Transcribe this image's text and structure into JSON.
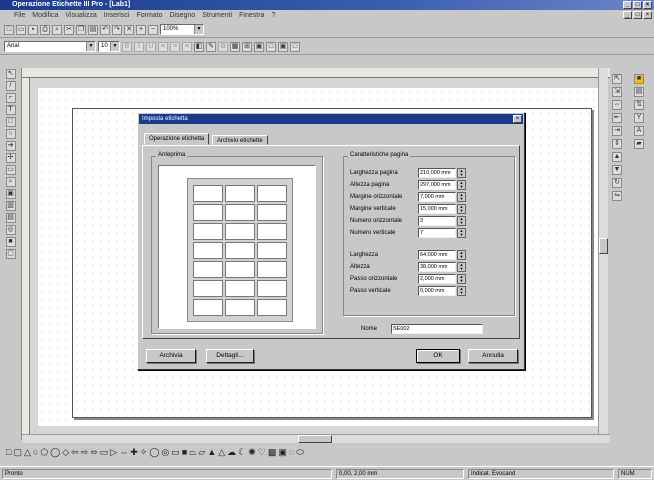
{
  "app": {
    "title": "Operazione Etichette III Pro - [Lab1]"
  },
  "menu": [
    "File",
    "Modifica",
    "Visualizza",
    "Inserisci",
    "Formato",
    "Disegno",
    "Strumenti",
    "Finestra",
    "?"
  ],
  "toolbar": {
    "zoom_value": "100%",
    "font_name": "Arial",
    "font_size": "10"
  },
  "dialog": {
    "title": "Imposta etichetta",
    "tabs": [
      "Operazione etichetta",
      "Archivio etichette"
    ],
    "preview_label": "Anteprima",
    "page_group_label": "Caratteristiche pagina",
    "fields": [
      {
        "label": "Larghezza pagina",
        "value": "210,000 mm"
      },
      {
        "label": "Altezza pagina",
        "value": "297,000 mm"
      },
      {
        "label": "Margine orizzontale",
        "value": "7,000 mm"
      },
      {
        "label": "Margine verticale",
        "value": "15,000 mm"
      },
      {
        "label": "Numero orizzontale",
        "value": "3"
      },
      {
        "label": "Numero verticale",
        "value": "7"
      }
    ],
    "fields2": [
      {
        "label": "Larghezza",
        "value": "64,000 mm"
      },
      {
        "label": "Altezza",
        "value": "38,000 mm"
      },
      {
        "label": "Passo orizzontale",
        "value": "2,000 mm"
      },
      {
        "label": "Passo verticale",
        "value": "0,000 mm"
      }
    ],
    "name_label": "Nome",
    "name_value": "SE002",
    "buttons": {
      "archive": "Archivia",
      "details": "Dettagli...",
      "ok": "OK",
      "cancel": "Annulla"
    }
  },
  "status": {
    "ready": "Pronto",
    "coords": "0,00, 2,00 mm",
    "tool": "Indicat. Evocand",
    "num": "NUM"
  }
}
